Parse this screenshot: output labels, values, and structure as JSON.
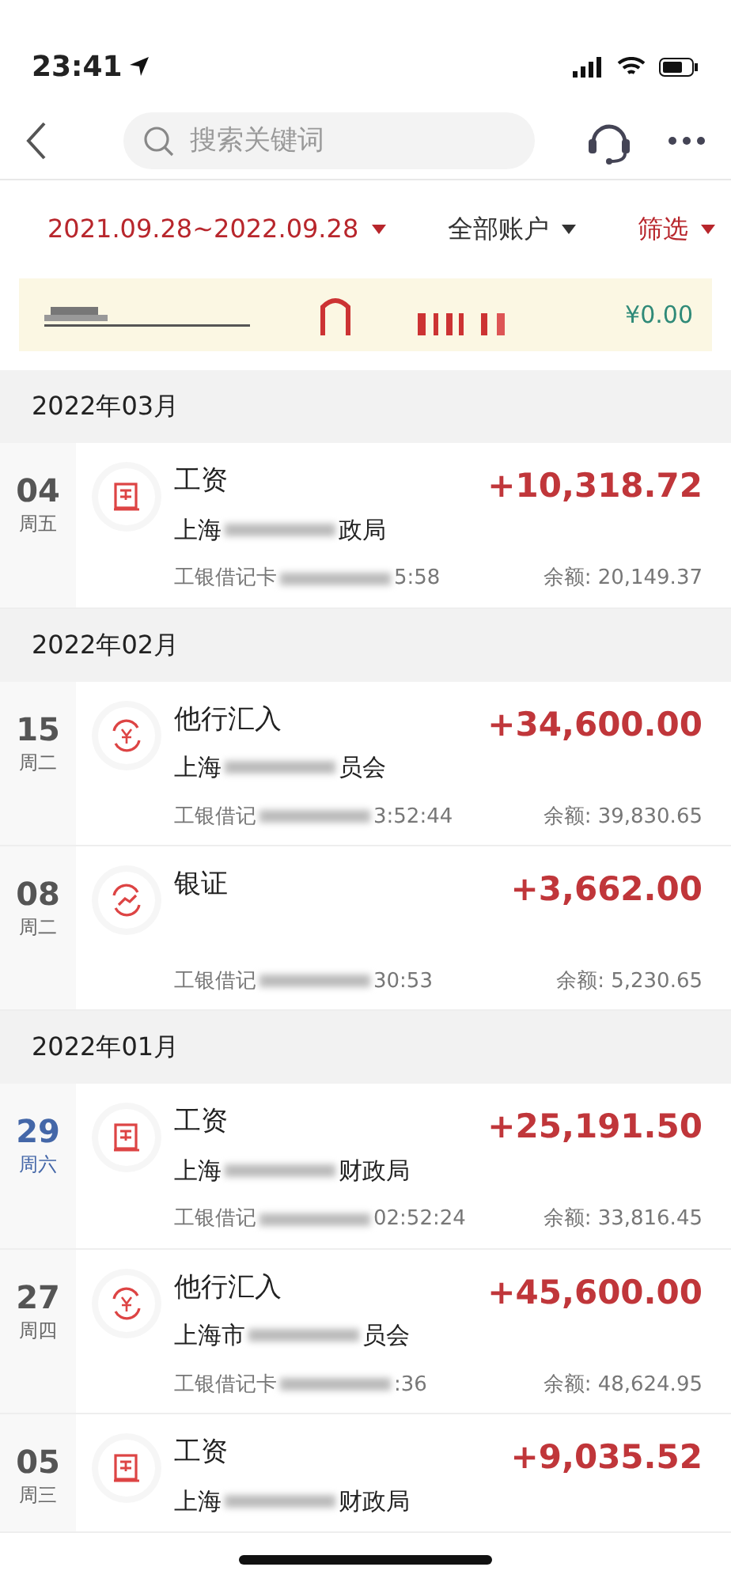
{
  "status_bar": {
    "time": "23:41"
  },
  "nav": {
    "search": {
      "placeholder": "搜索关键词"
    }
  },
  "filters": [
    {
      "label": "2021.09.28~2022.09.28",
      "kind": "accent"
    },
    {
      "label": "全部账户",
      "kind": "plain"
    },
    {
      "label": "筛选",
      "kind": "accent"
    }
  ],
  "banner": {
    "amount": "¥0.00"
  },
  "months": [
    {
      "title": "2022年03月",
      "transactions": [
        {
          "day": "04",
          "weekday": "周五",
          "weekend": false,
          "kind": "salary",
          "category": "工资",
          "payer_start": "上海",
          "payer_end": "政局",
          "card": "工银借记卡",
          "time": "5:58",
          "amount": "+10,318.72",
          "balance": "余额: 20,149.37"
        }
      ]
    },
    {
      "title": "2022年02月",
      "transactions": [
        {
          "day": "15",
          "weekday": "周二",
          "weekend": false,
          "kind": "transfer",
          "category": "他行汇入",
          "payer_start": "上海",
          "payer_end": "员会",
          "card": "工银借记",
          "time": "3:52:44",
          "amount": "+34,600.00",
          "balance": "余额: 39,830.65"
        },
        {
          "day": "08",
          "weekday": "周二",
          "weekend": false,
          "kind": "stock",
          "category": "银证",
          "card": "工银借记",
          "time": "30:53",
          "amount": "+3,662.00",
          "balance": "余额: 5,230.65"
        }
      ]
    },
    {
      "title": "2022年01月",
      "transactions": [
        {
          "day": "29",
          "weekday": "周六",
          "weekend": true,
          "kind": "salary",
          "category": "工资",
          "payer_start": "上海",
          "payer_end": "财政局",
          "card": "工银借记",
          "time": "02:52:24",
          "amount": "+25,191.50",
          "balance": "余额: 33,816.45"
        },
        {
          "day": "27",
          "weekday": "周四",
          "weekend": false,
          "kind": "transfer",
          "category": "他行汇入",
          "payer_start": "上海市",
          "payer_end": "员会",
          "card": "工银借记卡",
          "time": ":36",
          "amount": "+45,600.00",
          "balance": "余额: 48,624.95"
        },
        {
          "day": "05",
          "weekday": "周三",
          "weekend": false,
          "kind": "salary",
          "category": "工资",
          "payer_start": "上海",
          "payer_end": "财政局",
          "amount": "+9,035.52"
        }
      ]
    }
  ]
}
